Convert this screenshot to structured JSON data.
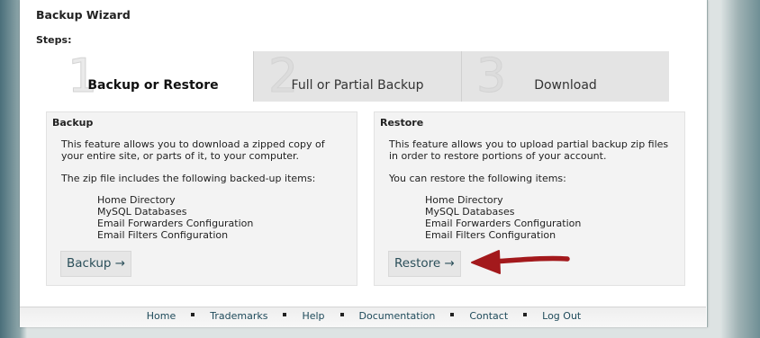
{
  "wizard": {
    "title": "Backup Wizard",
    "steps_label": "Steps:"
  },
  "steps": [
    {
      "number": "1",
      "label": "Backup or Restore"
    },
    {
      "number": "2",
      "label": "Full or Partial Backup"
    },
    {
      "number": "3",
      "label": "Download"
    }
  ],
  "backup": {
    "heading": "Backup",
    "description": "This feature allows you to download a zipped copy of your entire site, or parts of it, to your computer.",
    "items_intro": "The zip file includes the following backed-up items:",
    "items": [
      "Home Directory",
      "MySQL Databases",
      "Email Forwarders Configuration",
      "Email Filters Configuration"
    ],
    "button": "Backup →"
  },
  "restore": {
    "heading": "Restore",
    "description": "This feature allows you to upload partial backup zip files in order to restore portions of your account.",
    "items_intro": "You can restore the following items:",
    "items": [
      "Home Directory",
      "MySQL Databases",
      "Email Forwarders Configuration",
      "Email Filters Configuration"
    ],
    "button": "Restore →"
  },
  "annotation": {
    "icon": "red-arrow-icon",
    "color": "#a3191c"
  },
  "footer": {
    "links": [
      "Home",
      "Trademarks",
      "Help",
      "Documentation",
      "Contact",
      "Log Out"
    ]
  }
}
